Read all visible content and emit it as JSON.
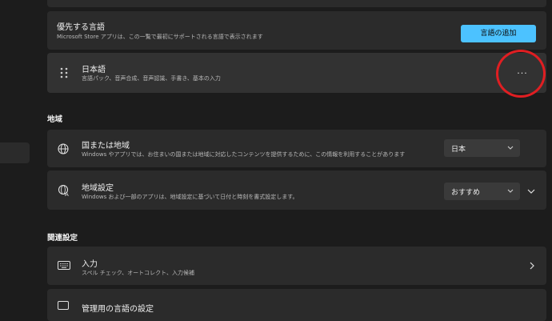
{
  "preferred": {
    "title": "優先する言語",
    "desc": "Microsoft Store アプリは、この一覧で最初にサポートされる言語で表示されます",
    "add_button": "言語の追加"
  },
  "language_item": {
    "title": "日本語",
    "desc": "言語パック、音声合成、音声認識、手書き、基本の入力",
    "more_label": "···"
  },
  "region_section": {
    "heading": "地域"
  },
  "country": {
    "title": "国または地域",
    "desc": "Windows やアプリでは、お住まいの国または地域に対応したコンテンツを提供するために、この情報を利用することがあります",
    "value": "日本"
  },
  "regional_format": {
    "title": "地域設定",
    "desc": "Windows および一部のアプリは、地域設定に基づいて日付と時刻を書式設定します。",
    "value": "おすすめ"
  },
  "related_section": {
    "heading": "関連設定"
  },
  "input": {
    "title": "入力",
    "desc": "スペル チェック、オートコレクト、入力候補"
  },
  "admin_language": {
    "title": "管理用の言語の設定"
  },
  "highlight_color": "#e01e22",
  "accent_color": "#4cc2ff"
}
